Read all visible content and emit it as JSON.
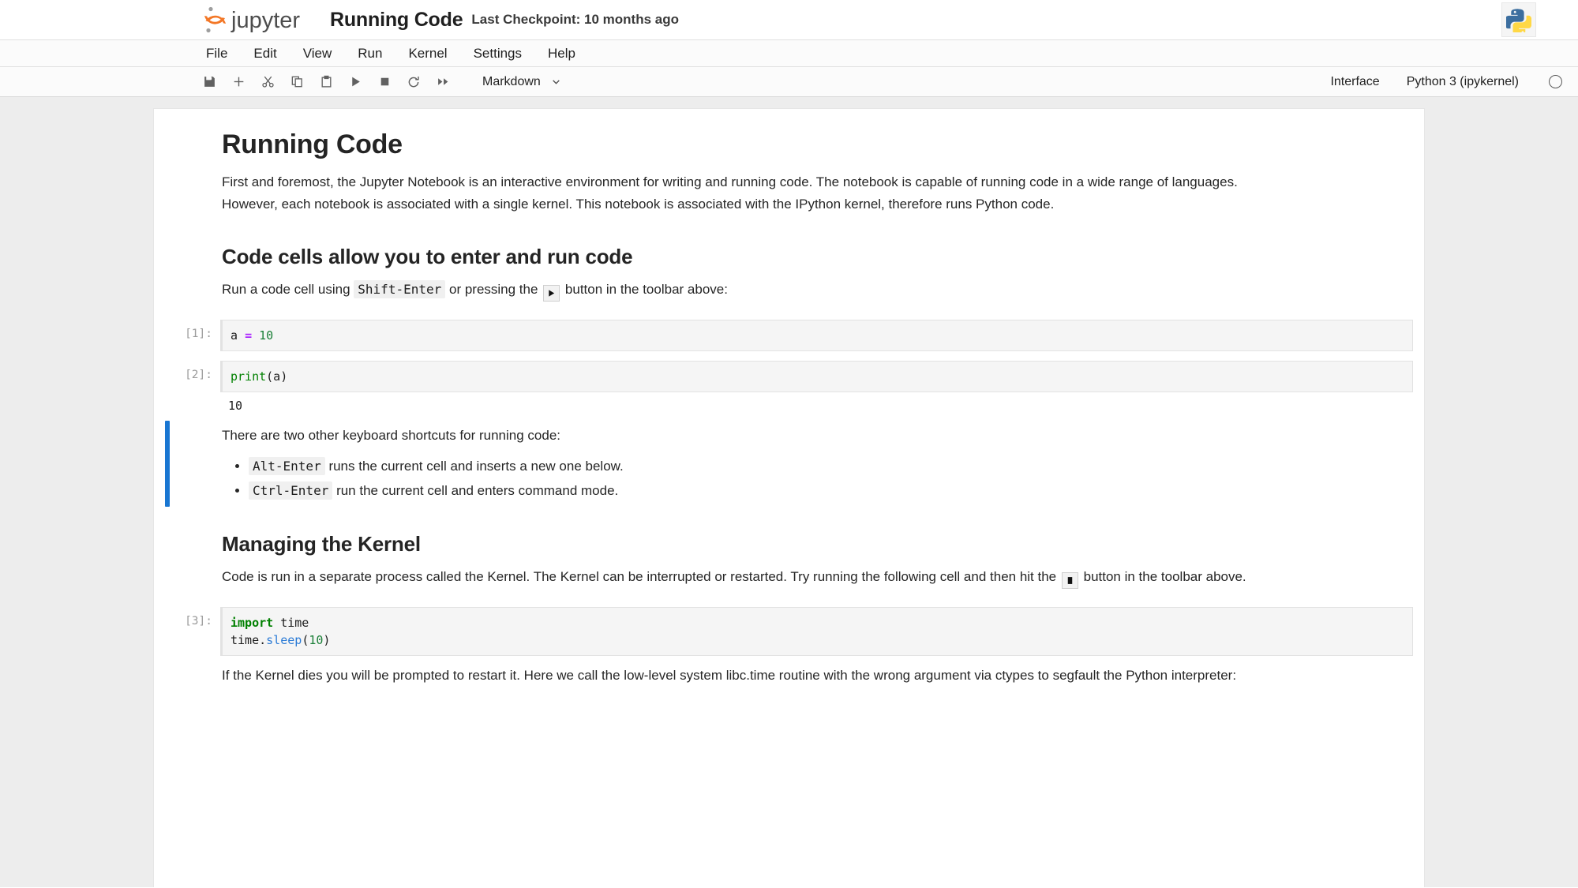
{
  "titlebar": {
    "brand": "jupyter",
    "notebook_title": "Running Code",
    "checkpoint": "Last Checkpoint: 10 months ago",
    "python_logo": "python-logo"
  },
  "menubar": {
    "items": [
      {
        "label": "File"
      },
      {
        "label": "Edit"
      },
      {
        "label": "View"
      },
      {
        "label": "Run"
      },
      {
        "label": "Kernel"
      },
      {
        "label": "Settings"
      },
      {
        "label": "Help"
      }
    ]
  },
  "toolbar": {
    "buttons": [
      {
        "name": "save-button",
        "icon": "save-icon"
      },
      {
        "name": "insert-cell-button",
        "icon": "plus-icon"
      },
      {
        "name": "cut-cell-button",
        "icon": "scissors-icon"
      },
      {
        "name": "copy-cell-button",
        "icon": "copy-icon"
      },
      {
        "name": "paste-cell-button",
        "icon": "clipboard-icon"
      },
      {
        "name": "run-cell-button",
        "icon": "play-icon"
      },
      {
        "name": "interrupt-kernel-button",
        "icon": "stop-icon"
      },
      {
        "name": "restart-kernel-button",
        "icon": "restart-icon"
      },
      {
        "name": "restart-run-all-button",
        "icon": "fast-forward-icon"
      }
    ],
    "cell_type": "Markdown",
    "interface_label": "Interface",
    "kernel_name": "Python 3 (ipykernel)",
    "kernel_status": "idle"
  },
  "notebook": {
    "heading_1": "Running Code",
    "intro_paragraph": "First and foremost, the Jupyter Notebook is an interactive environment for writing and running code. The notebook is capable of running code in a wide range of languages. However, each notebook is associated with a single kernel. This notebook is associated with the IPython kernel, therefore runs Python code.",
    "heading_code_cells": "Code cells allow you to enter and run code",
    "run_cell_text_1": "Run a code cell using",
    "run_cell_kbd": "Shift-Enter",
    "run_cell_text_2": "or pressing the",
    "run_cell_text_3": "button in the toolbar above:",
    "cell1": {
      "prompt": "[1]:",
      "code_var": "a",
      "code_op": "=",
      "code_num": "10"
    },
    "cell2": {
      "prompt": "[2]:",
      "code_fn": "print",
      "code_args": "(a)",
      "output": "10"
    },
    "shortcuts_intro": "There are two other keyboard shortcuts for running code:",
    "shortcuts": [
      {
        "kbd": "Alt-Enter",
        "text": "runs the current cell and inserts a new one below."
      },
      {
        "kbd": "Ctrl-Enter",
        "text": "run the current cell and enters command mode."
      }
    ],
    "heading_kernel": "Managing the Kernel",
    "kernel_text_1": "Code is run in a separate process called the Kernel. The Kernel can be interrupted or restarted. Try running the following cell and then hit the",
    "kernel_text_2": "button in the toolbar above.",
    "cell3": {
      "prompt": "[3]:",
      "kw_import": "import",
      "mod_time": " time",
      "line2_obj": "time.",
      "line2_mth": "sleep",
      "line2_open": "(",
      "line2_num": "10",
      "line2_close": ")"
    },
    "kernel_dies_paragraph": "If the Kernel dies you will be prompted to restart it. Here we call the low-level system libc.time routine with the wrong argument via ctypes to segfault the Python interpreter:"
  },
  "colors": {
    "jupyter_orange": "#f37726",
    "selection_blue": "#1976d2",
    "code_bg": "#f5f5f5",
    "page_bg": "#ededed"
  }
}
